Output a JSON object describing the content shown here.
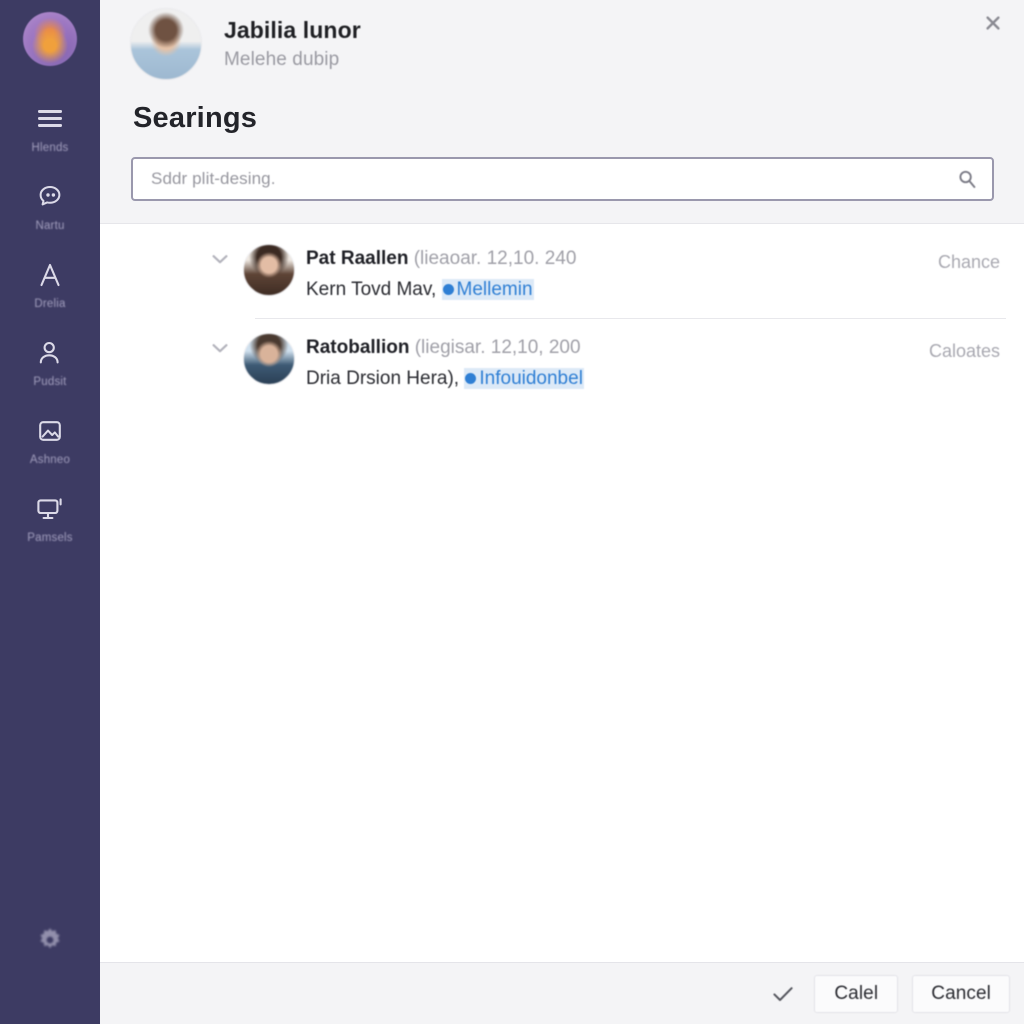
{
  "rail": {
    "avatar_name": "user-avatar",
    "items": [
      {
        "label": "Hlends",
        "icon": "menu-icon"
      },
      {
        "label": "Nartu",
        "icon": "chat-icon"
      },
      {
        "label": "Drelia",
        "icon": "text-icon"
      },
      {
        "label": "Pudsit",
        "icon": "person-icon"
      },
      {
        "label": "Ashneo",
        "icon": "image-icon"
      },
      {
        "label": "Pamsels",
        "icon": "monitor-icon"
      }
    ],
    "bottom_icon": "gear-icon"
  },
  "header": {
    "name": "Jabilia lunor",
    "subtitle": "Melehe dubip",
    "close_icon": "close-icon"
  },
  "main": {
    "title": "Searings",
    "search": {
      "placeholder": "Sddr plit-desing.",
      "value": "",
      "icon": "search-icon"
    },
    "results": [
      {
        "title": "Pat Raallen",
        "meta": "(lieaoar. 12,10. 240",
        "detail": "Kern Tovd Mav,",
        "link": "Mellemin",
        "right": "Chance",
        "chevron": "chevron-down-icon"
      },
      {
        "title": "Ratoballion",
        "meta": "(liegisar. 12,10, 200",
        "detail": "Dria Drsion Hera),",
        "link": "Infouidonbel",
        "right": "Caloates",
        "chevron": "chevron-down-icon"
      }
    ]
  },
  "footer": {
    "check_icon": "check-icon",
    "confirm_label": "Calel",
    "cancel_label": "Cancel"
  },
  "colors": {
    "rail_bg": "#3d3b63",
    "band_bg": "#f4f4f6",
    "link": "#2f7fd4",
    "border_focus": "#9a98ad"
  }
}
